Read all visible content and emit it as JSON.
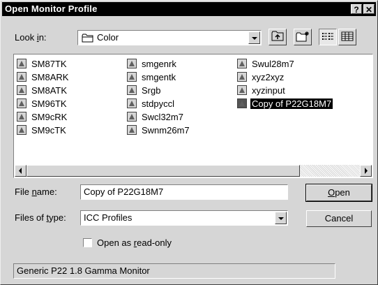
{
  "window": {
    "title": "Open Monitor Profile",
    "help_glyph": "?",
    "close_glyph": "✕"
  },
  "lookin": {
    "label_pre": "Look ",
    "label_u": "i",
    "label_post": "n:",
    "folder": "Color"
  },
  "files": [
    {
      "name": "SM87TK",
      "selected": false
    },
    {
      "name": "SM8ARK",
      "selected": false
    },
    {
      "name": "SM8ATK",
      "selected": false
    },
    {
      "name": "SM96TK",
      "selected": false
    },
    {
      "name": "SM9cRK",
      "selected": false
    },
    {
      "name": "SM9cTK",
      "selected": false
    },
    {
      "name": "smgenrk",
      "selected": false
    },
    {
      "name": "smgentk",
      "selected": false
    },
    {
      "name": "Srgb",
      "selected": false
    },
    {
      "name": "stdpyccl",
      "selected": false
    },
    {
      "name": "Swcl32m7",
      "selected": false
    },
    {
      "name": "Swnm26m7",
      "selected": false
    },
    {
      "name": "Swul28m7",
      "selected": false
    },
    {
      "name": "xyz2xyz",
      "selected": false
    },
    {
      "name": "xyzinput",
      "selected": false
    },
    {
      "name": "Copy of P22G18M7",
      "selected": true
    }
  ],
  "filename": {
    "label_pre": "File ",
    "label_u": "n",
    "label_post": "ame:",
    "value": "Copy of P22G18M7"
  },
  "filetype": {
    "label_pre": "Files of ",
    "label_u": "t",
    "label_post": "ype:",
    "value": "ICC Profiles"
  },
  "buttons": {
    "open_u": "O",
    "open_rest": "pen",
    "cancel": "Cancel"
  },
  "readonly": {
    "label_pre": "Open as ",
    "label_u": "r",
    "label_post": "ead-only",
    "checked": false
  },
  "status_text": "Generic P22 1.8 Gamma Monitor",
  "icons": {
    "folder": "folder-icon",
    "up": "up-folder-icon",
    "new_folder": "new-folder-icon",
    "list_view": "list-view-icon",
    "details_view": "details-view-icon",
    "file": "icc-profile-icon"
  }
}
